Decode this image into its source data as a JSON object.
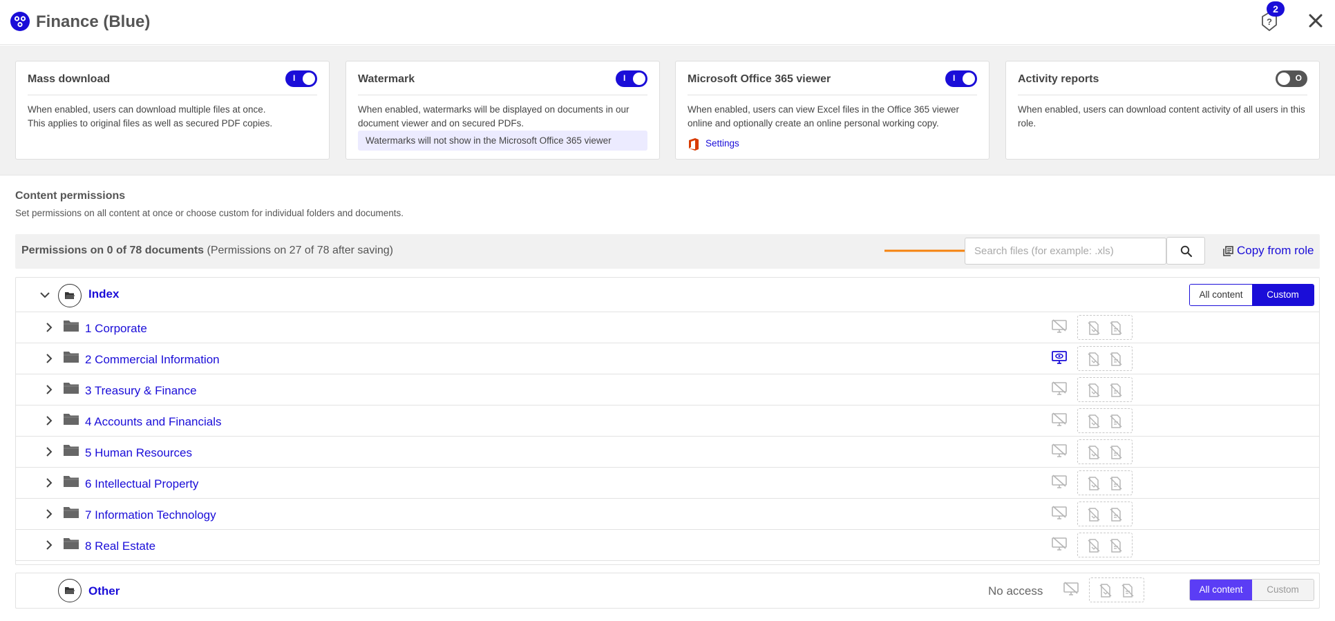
{
  "header": {
    "title": "Finance (Blue)",
    "help_badge_count": "2",
    "logo_icon": "people-group-icon",
    "help_icon": "help-question-icon",
    "close_icon": "close-icon"
  },
  "colors": {
    "accent": "#1a0dd8",
    "all_content_active": "#5b3df5",
    "arrow": "#f5830f"
  },
  "cards": {
    "mass_download": {
      "title": "Mass download",
      "enabled": true,
      "toggle_glyph": "I",
      "desc_line1": "When enabled, users can download multiple files at once.",
      "desc_line2": "This applies to original files as well as secured PDF copies."
    },
    "watermark": {
      "title": "Watermark",
      "enabled": true,
      "toggle_glyph": "I",
      "desc_line1": "When enabled, watermarks will be displayed on documents in our",
      "desc_line2": "document viewer and on secured PDFs.",
      "note": "Watermarks will not show in the Microsoft Office 365 viewer"
    },
    "office365": {
      "title": "Microsoft Office 365 viewer",
      "enabled": true,
      "toggle_glyph": "I",
      "desc_line1": "When enabled, users can view Excel files in the Office 365 viewer",
      "desc_line2": "online and optionally create an online personal working copy.",
      "settings_link": "Settings"
    },
    "activity_reports": {
      "title": "Activity reports",
      "enabled": false,
      "toggle_glyph": "O",
      "desc_line1": "When enabled, users can download content activity of all users in this",
      "desc_line2": "role."
    }
  },
  "content_permissions": {
    "title": "Content permissions",
    "subtitle": "Set permissions on all content at once or choose custom for individual folders and documents.",
    "count_bold": "Permissions on 0 of 78 documents",
    "count_after": "(Permissions on 27 of 78 after saving)",
    "search_placeholder": "Search files (for example: .xls)",
    "copy_from_role": "Copy from role"
  },
  "tree": {
    "root": {
      "label": "Index",
      "seg_all": "All content",
      "seg_custom": "Custom",
      "selected": "Custom"
    },
    "folders": [
      {
        "label": "1 Corporate",
        "viewer_enabled": false
      },
      {
        "label": "2 Commercial Information",
        "viewer_enabled": true
      },
      {
        "label": "3 Treasury & Finance",
        "viewer_enabled": false
      },
      {
        "label": "4 Accounts and Financials",
        "viewer_enabled": false
      },
      {
        "label": "5 Human Resources",
        "viewer_enabled": false
      },
      {
        "label": "6 Intellectual Property",
        "viewer_enabled": false
      },
      {
        "label": "7 Information Technology",
        "viewer_enabled": false
      },
      {
        "label": "8 Real Estate",
        "viewer_enabled": false
      }
    ],
    "other": {
      "label": "Other",
      "access": "No access",
      "seg_all": "All content",
      "seg_custom": "Custom",
      "selected": "All content"
    }
  }
}
